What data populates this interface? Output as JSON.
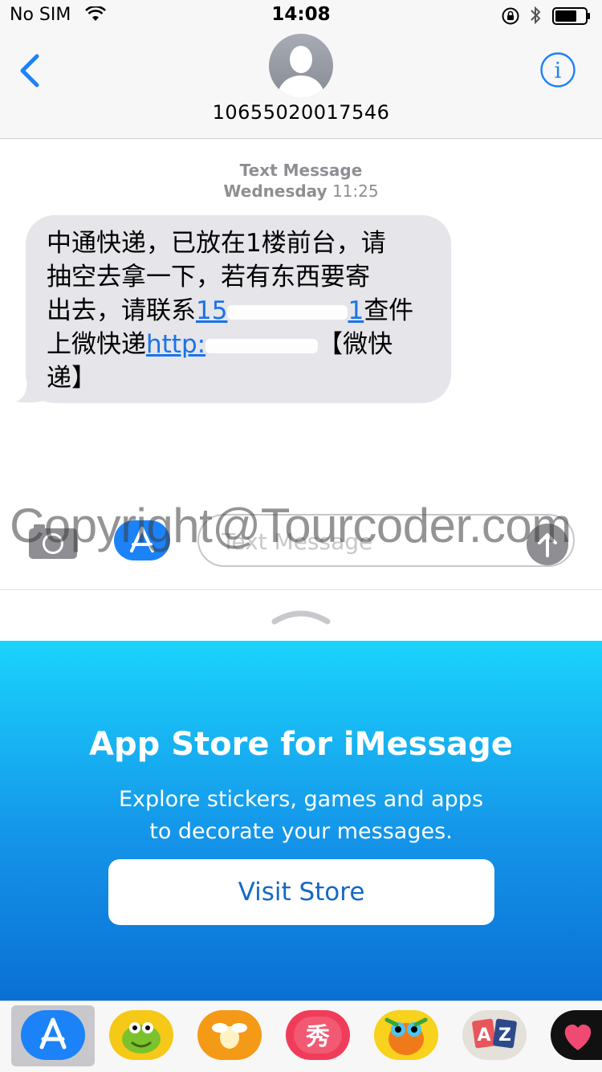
{
  "status_bar": {
    "carrier": "No SIM",
    "time": "14:08",
    "icons": [
      "wifi-icon",
      "orientation-lock-icon",
      "bluetooth-icon",
      "battery-icon"
    ]
  },
  "header": {
    "contact": "10655020017546",
    "back_icon": "chevron-left-icon",
    "info_icon": "info-icon"
  },
  "conversation": {
    "service_label": "Text Message",
    "day": "Wednesday",
    "time": "11:25",
    "message": {
      "line1": "中通快递，已放在1楼前台，请",
      "line2": "抽空去拿一下，若有东西要寄",
      "line3_pre": "出去，请联系",
      "line3_link_start": "15",
      "line3_link_end": "1",
      "line3_post": "查件",
      "line4_pre": "上微快递",
      "line4_link": "http:",
      "line4_post": "【微快",
      "line5": "递】"
    }
  },
  "composer": {
    "placeholder": "Text Message",
    "watermark": "Copyright@Tourcoder.com"
  },
  "promo": {
    "title": "App Store for iMessage",
    "subtitle_line1": "Explore stickers, games and apps",
    "subtitle_line2": "to decorate your messages.",
    "button": "Visit Store"
  },
  "tray": {
    "apps": [
      "app-store-icon",
      "om-nom-sticker-icon",
      "bee-app-icon",
      "xiu-app-icon",
      "bird-game-icon",
      "az-app-icon",
      "heart-app-icon"
    ],
    "xiu_label": "秀",
    "az_label_a": "A",
    "az_label_z": "Z"
  },
  "colors": {
    "ios_blue": "#1c82f8",
    "bubble_gray": "#e5e5ea",
    "promo_top": "#1bd4fc",
    "promo_bottom": "#0a6fd4"
  }
}
